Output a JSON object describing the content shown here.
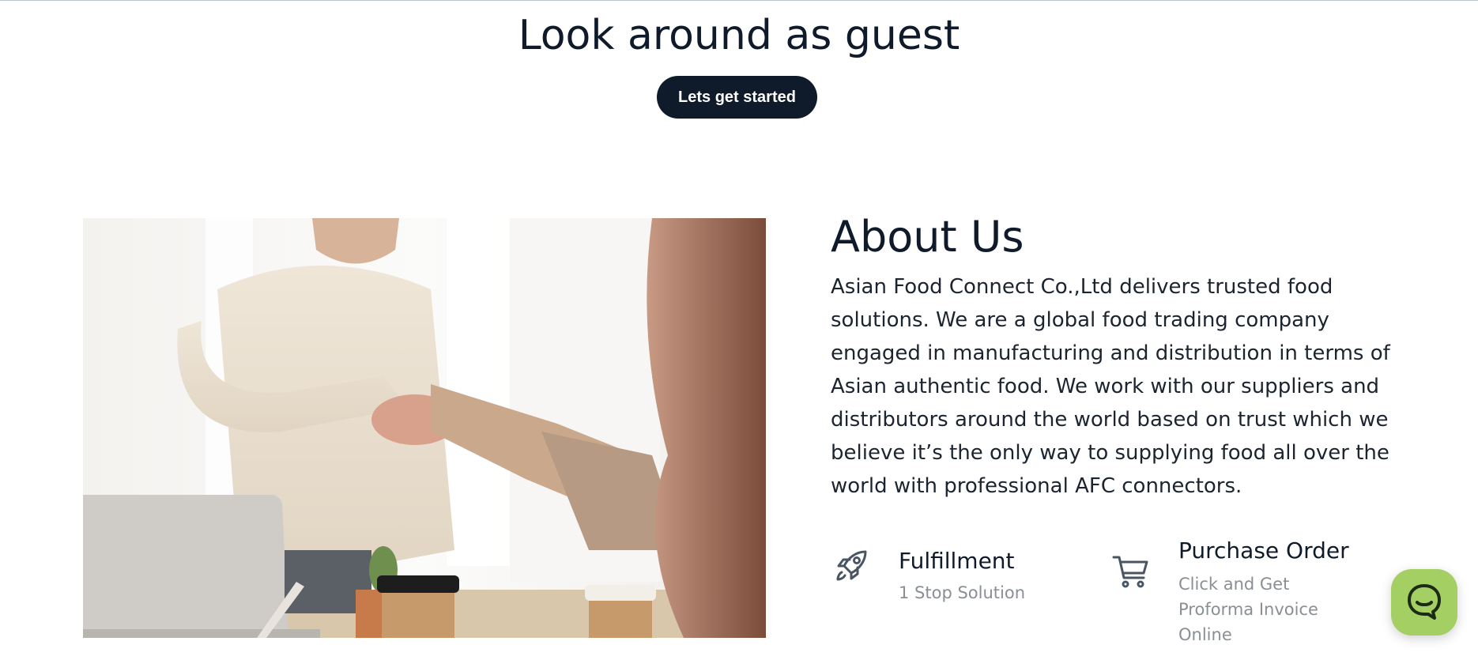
{
  "hero": {
    "title": "Look around as guest",
    "cta_label": "Lets get started"
  },
  "about": {
    "title": "About Us",
    "body": "Asian Food Connect Co.,Ltd delivers trusted food solutions. We are a global food trading company engaged in manufacturing and distribution in terms of Asian authentic food. We work with our suppliers and distributors around the world based on trust which we believe it’s the only way to supplying food all over the world with professional AFC connectors."
  },
  "features": [
    {
      "icon": "rocket-icon",
      "title": "Fulfillment",
      "subtitle": "1 Stop Solution"
    },
    {
      "icon": "shopping-cart-icon",
      "title": "Purchase Order",
      "subtitle": "Click and Get Proforma Invoice Online"
    }
  ],
  "chat": {
    "icon": "chat-icon"
  },
  "colors": {
    "primary": "#0f1a2a",
    "chat_widget": "#a4cf63",
    "muted_text": "#8a8f96"
  }
}
